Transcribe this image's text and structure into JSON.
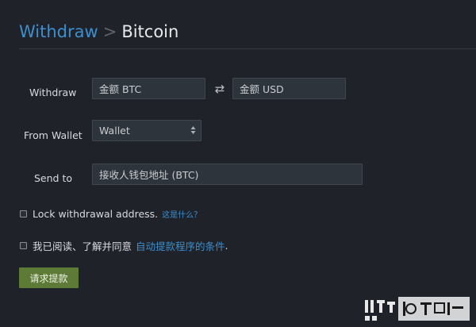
{
  "header": {
    "crumb": "Withdraw",
    "separator": ">",
    "current": "Bitcoin"
  },
  "form": {
    "withdraw_label": "Withdraw",
    "amount_btc_placeholder": "金额 BTC",
    "swap_icon": "⇄",
    "amount_usd_placeholder": "金额 USD",
    "wallet_label": "From Wallet",
    "wallet_selected": "Wallet",
    "send_to_label": "Send to",
    "address_placeholder": "接收人钱包地址 (BTC)"
  },
  "options": {
    "lock_label": "Lock withdrawal address.",
    "lock_help_link": "这是什么？",
    "agree_label": "我已阅读、了解并同意",
    "agree_link": "自动提款程序的条件",
    "agree_period": "."
  },
  "actions": {
    "submit_label": "请求提款"
  },
  "colors": {
    "background": "#1f2329",
    "accent": "#3b8fd0",
    "submit": "#5d7a36",
    "field": "#2e343b"
  }
}
